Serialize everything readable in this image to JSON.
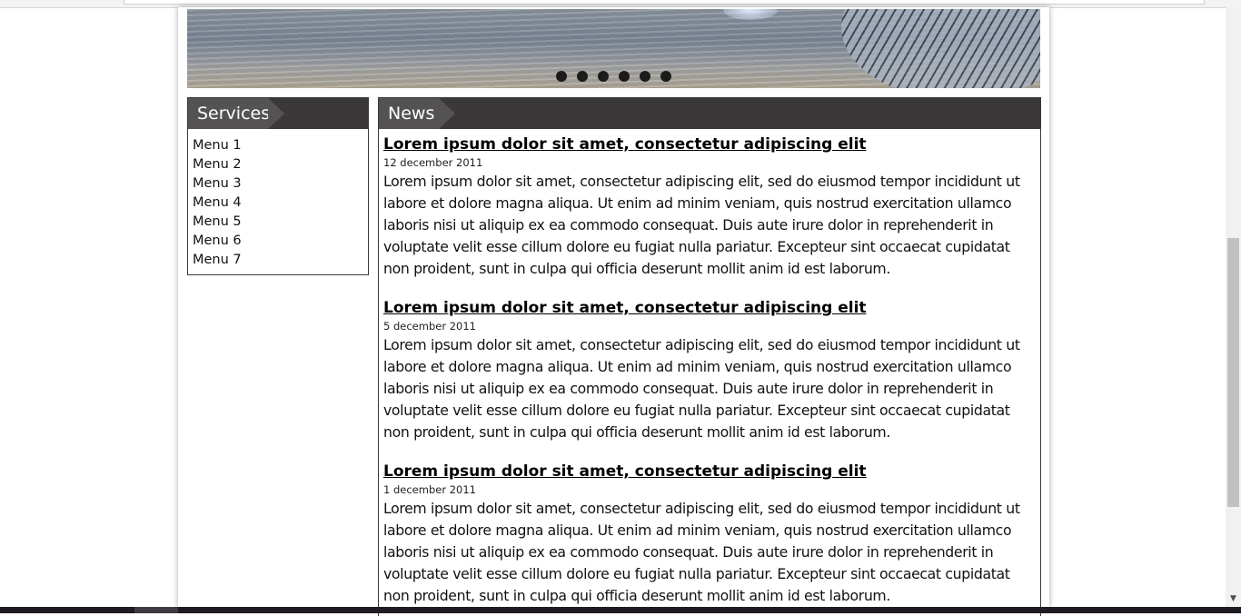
{
  "slider": {
    "dots": [
      "1",
      "2",
      "3",
      "4",
      "5",
      "6"
    ]
  },
  "services": {
    "title": "Services",
    "items": [
      "Menu 1",
      "Menu 2",
      "Menu 3",
      "Menu 4",
      "Menu 5",
      "Menu 6",
      "Menu 7"
    ]
  },
  "news": {
    "title": "News",
    "items": [
      {
        "title": "Lorem ipsum dolor sit amet, consectetur adipiscing elit",
        "date": "12 december 2011",
        "text": "Lorem ipsum dolor sit amet, consectetur adipiscing elit, sed do eiusmod tempor incididunt ut labore et dolore magna aliqua. Ut enim ad minim veniam, quis nostrud exercitation ullamco laboris nisi ut aliquip ex ea commodo consequat. Duis aute irure dolor in reprehenderit in voluptate velit esse cillum dolore eu fugiat nulla pariatur. Excepteur sint occaecat cupidatat non proident, sunt in culpa qui officia deserunt mollit anim id est laborum."
      },
      {
        "title": "Lorem ipsum dolor sit amet, consectetur adipiscing elit",
        "date": "5 december 2011",
        "text": "Lorem ipsum dolor sit amet, consectetur adipiscing elit, sed do eiusmod tempor incididunt ut labore et dolore magna aliqua. Ut enim ad minim veniam, quis nostrud exercitation ullamco laboris nisi ut aliquip ex ea commodo consequat. Duis aute irure dolor in reprehenderit in voluptate velit esse cillum dolore eu fugiat nulla pariatur. Excepteur sint occaecat cupidatat non proident, sunt in culpa qui officia deserunt mollit anim id est laborum."
      },
      {
        "title": "Lorem ipsum dolor sit amet, consectetur adipiscing elit",
        "date": "1 december 2011",
        "text": "Lorem ipsum dolor sit amet, consectetur adipiscing elit, sed do eiusmod tempor incididunt ut labore et dolore magna aliqua. Ut enim ad minim veniam, quis nostrud exercitation ullamco laboris nisi ut aliquip ex ea commodo consequat. Duis aute irure dolor in reprehenderit in voluptate velit esse cillum dolore eu fugiat nulla pariatur. Excepteur sint occaecat cupidatat non proident, sunt in culpa qui officia deserunt mollit anim id est laborum."
      }
    ]
  },
  "colors": {
    "panel_header": "#3a3838",
    "panel_tab": "#545252",
    "slider_dot": "#1b1b1b"
  }
}
